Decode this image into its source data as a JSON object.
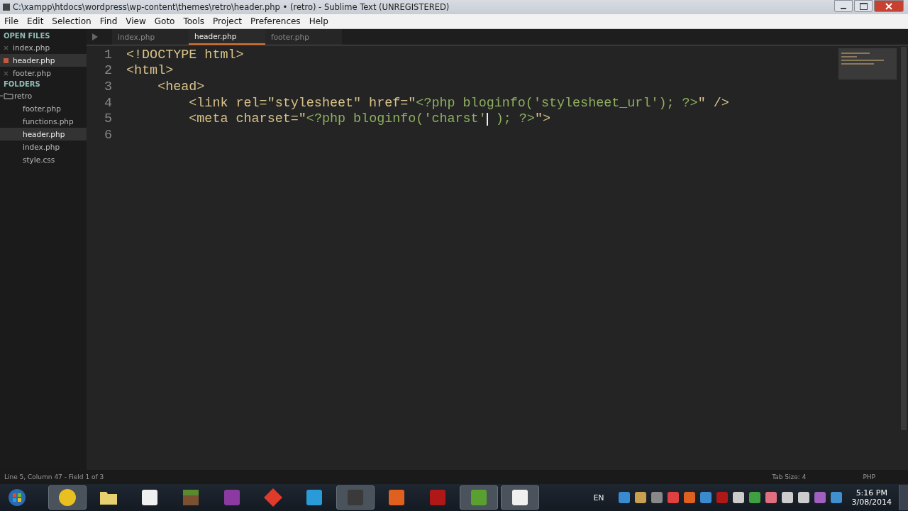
{
  "window": {
    "title": "C:\\xampp\\htdocs\\wordpress\\wp-content\\themes\\retro\\header.php • (retro) - Sublime Text (UNREGISTERED)"
  },
  "menu": [
    "File",
    "Edit",
    "Selection",
    "Find",
    "View",
    "Goto",
    "Tools",
    "Project",
    "Preferences",
    "Help"
  ],
  "sidebar": {
    "open_files_heading": "OPEN FILES",
    "open_files": [
      {
        "label": "index.php",
        "selected": false,
        "modified": false
      },
      {
        "label": "header.php",
        "selected": true,
        "modified": true
      },
      {
        "label": "footer.php",
        "selected": false,
        "modified": false
      }
    ],
    "folders_heading": "FOLDERS",
    "folders": [
      {
        "label": "retro",
        "expanded": true,
        "children": [
          {
            "label": "footer.php",
            "selected": false
          },
          {
            "label": "functions.php",
            "selected": false
          },
          {
            "label": "header.php",
            "selected": true
          },
          {
            "label": "index.php",
            "selected": false
          },
          {
            "label": "style.css",
            "selected": false
          }
        ]
      }
    ]
  },
  "tabs": [
    {
      "label": "index.php",
      "selected": false
    },
    {
      "label": "header.php",
      "selected": true
    },
    {
      "label": "footer.php",
      "selected": false
    }
  ],
  "code": [
    {
      "number": "1",
      "segments": [
        {
          "kind": "tag",
          "text": "<!DOCTYPE html>"
        }
      ]
    },
    {
      "number": "2",
      "segments": [
        {
          "kind": "tag",
          "text": "<html>"
        }
      ]
    },
    {
      "number": "3",
      "segments": [
        {
          "kind": "tag",
          "text": "    <head>"
        }
      ]
    },
    {
      "number": "4",
      "segments": [
        {
          "kind": "tag",
          "text": "        <link rel=\"stylesheet\" href=\""
        },
        {
          "kind": "php",
          "text": "<?php bloginfo('stylesheet_url'); ?>"
        },
        {
          "kind": "tag",
          "text": "\" />"
        }
      ]
    },
    {
      "number": "5",
      "segments": [
        {
          "kind": "tag",
          "text": "        <meta charset=\""
        },
        {
          "kind": "php",
          "text": "<?php bloginfo('charst'"
        },
        {
          "kind": "cursor"
        },
        {
          "kind": "php",
          "text": " ); ?>"
        },
        {
          "kind": "tag",
          "text": "\">"
        }
      ]
    },
    {
      "number": "6"
    }
  ],
  "status_bar": {
    "position": "Line 5, Column 47 - Field 1 of 3",
    "tab_size": "Tab Size: 4",
    "syntax": "PHP"
  },
  "taskbar": {
    "language": "EN",
    "time": "5:16 PM",
    "date": "3/08/2014"
  }
}
